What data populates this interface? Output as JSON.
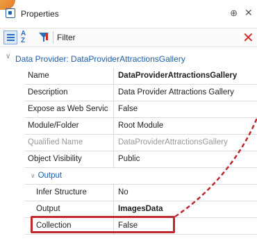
{
  "window": {
    "title": "Properties",
    "pin_glyph": "⊕",
    "close_glyph": "✕"
  },
  "toolbar": {
    "filter_label": "Filter",
    "clear_glyph": "✕",
    "alpha_top": "A",
    "alpha_bottom": "Z"
  },
  "group": {
    "label": "Data Provider: DataProviderAttractionsGallery"
  },
  "subgroup": {
    "label": "Output"
  },
  "rows": [
    {
      "name": "Name",
      "value": "DataProviderAttractionsGallery"
    },
    {
      "name": "Description",
      "value": "Data Provider Attractions Gallery"
    },
    {
      "name": "Expose as Web Servic",
      "value": "False"
    },
    {
      "name": "Module/Folder",
      "value": "Root Module"
    },
    {
      "name": "Qualified Name",
      "value": "DataProviderAttractionsGallery"
    },
    {
      "name": "Object Visibility",
      "value": "Public"
    }
  ],
  "sub_rows": [
    {
      "name": "Infer Structure",
      "value": "No"
    },
    {
      "name": "Output",
      "value": "ImagesData"
    },
    {
      "name": "Collection",
      "value": "False"
    }
  ],
  "colors": {
    "accent": "#1f5fa8",
    "highlight": "#c0272d",
    "clear": "#d12b2b"
  }
}
